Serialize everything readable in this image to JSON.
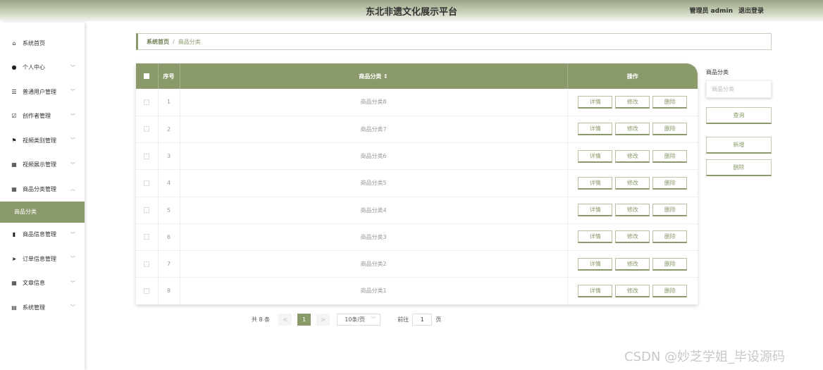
{
  "header": {
    "title": "东北非遗文化展示平台",
    "user": "管理员 admin",
    "logout": "退出登录"
  },
  "sidebar": {
    "items": [
      {
        "label": "系统首页",
        "icon": "home-icon",
        "glyph": "⌂",
        "expandable": false
      },
      {
        "label": "个人中心",
        "icon": "person-icon",
        "glyph": "●",
        "expandable": true
      },
      {
        "label": "普通用户管理",
        "icon": "sliders-icon",
        "glyph": "☰",
        "expandable": true
      },
      {
        "label": "创作者管理",
        "icon": "check-square-icon",
        "glyph": "☑",
        "expandable": true
      },
      {
        "label": "视频类别管理",
        "icon": "flag-icon",
        "glyph": "⚑",
        "expandable": true
      },
      {
        "label": "视频展示管理",
        "icon": "grid-icon",
        "glyph": "▦",
        "expandable": true
      },
      {
        "label": "商品分类管理",
        "icon": "grid-icon",
        "glyph": "▦",
        "expandable": true,
        "open": true
      },
      {
        "label": "商品分类",
        "sub": true
      },
      {
        "label": "商品信息管理",
        "icon": "bar-chart-icon",
        "glyph": "▮",
        "expandable": true
      },
      {
        "label": "订单信息管理",
        "icon": "send-icon",
        "glyph": "➤",
        "expandable": true
      },
      {
        "label": "文章信息",
        "icon": "grid-icon",
        "glyph": "▦",
        "expandable": true
      },
      {
        "label": "系统管理",
        "icon": "clipboard-icon",
        "glyph": "▤",
        "expandable": true
      }
    ]
  },
  "breadcrumb": {
    "home": "系统首页",
    "sep": "/",
    "current": "商品分类"
  },
  "table": {
    "headers": {
      "index": "序号",
      "name": "商品分类",
      "sort_glyph": "⇕",
      "actions": "操作"
    },
    "rows": [
      {
        "index": "1",
        "name": "商品分类8"
      },
      {
        "index": "2",
        "name": "商品分类7"
      },
      {
        "index": "3",
        "name": "商品分类6"
      },
      {
        "index": "4",
        "name": "商品分类5"
      },
      {
        "index": "5",
        "name": "商品分类4"
      },
      {
        "index": "6",
        "name": "商品分类3"
      },
      {
        "index": "7",
        "name": "商品分类2"
      },
      {
        "index": "8",
        "name": "商品分类1"
      }
    ],
    "row_actions": {
      "detail": "详情",
      "edit": "修改",
      "delete": "删除"
    }
  },
  "pagination": {
    "total": "共 8 条",
    "prev": "<",
    "current_page": "1",
    "next": ">",
    "page_size": "10条/页",
    "goto_label": "前往",
    "goto_value": "1",
    "goto_suffix": "页"
  },
  "search_panel": {
    "title": "商品分类",
    "placeholder": "商品分类",
    "query": "查询",
    "add": "新增",
    "delete": "删除"
  },
  "watermark": "CSDN @妙芝学姐_毕设源码",
  "colors": {
    "accent": "#8a9a6a"
  }
}
